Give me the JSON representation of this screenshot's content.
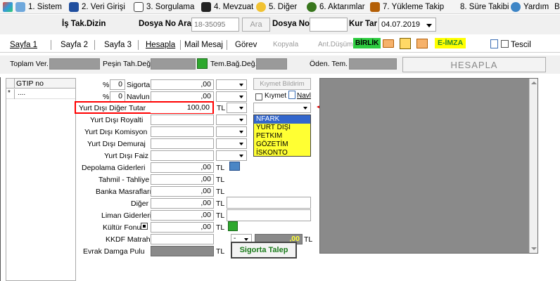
{
  "menu": [
    {
      "label": "1. Sistem",
      "icon": "system-icon"
    },
    {
      "label": "2. Veri Girişi",
      "icon": "edit-icon"
    },
    {
      "label": "3. Sorgulama",
      "icon": "query-icon"
    },
    {
      "label": "4. Mevzuat",
      "icon": "book-icon"
    },
    {
      "label": "5. Diğer",
      "icon": "people-icon"
    },
    {
      "label": "6. Aktarımlar",
      "icon": "transfer-icon"
    },
    {
      "label": "7. Yükleme Takip",
      "icon": "truck-icon"
    },
    {
      "label": "8. Süre Takibi",
      "icon": ""
    },
    {
      "label": "Yardım",
      "icon": "help-icon"
    },
    {
      "label": "B",
      "icon": ""
    }
  ],
  "header": {
    "title": "İş Tak.Dizin",
    "dosya_no_ara_label": "Dosya No Ara",
    "dosya_no_ara_placeholder": "18-35095",
    "ara_button": "Ara",
    "dosya_no_label": "Dosya No",
    "dosya_no_value": "",
    "kur_tar_label": "Kur Tar",
    "kur_tar_value": "04.07.2019"
  },
  "tabs": {
    "items": [
      "Sayfa 1",
      "Sayfa 2",
      "Sayfa 3",
      "Hesapla",
      "Mail Mesaj",
      "Görev",
      "Kopyala",
      "Ant.Düşüm"
    ],
    "birlik": "BİRLİK",
    "eimza": "E-İMZA",
    "tescil": "Tescil"
  },
  "totals": {
    "toplam_ver": "Toplam Ver.",
    "pesin_tah_deg": "Peşin Tah.Değ.",
    "tem_bag_deg": "Tem.Bağ.Değ.",
    "oden_tem": "Öden. Tem.",
    "hesapla": "HESAPLA"
  },
  "grid": {
    "header": "GTIP no",
    "row_marker": "*",
    "row_value": "...."
  },
  "form": {
    "pct1_label": "%",
    "pct1_value": "0",
    "sigorta_label": "Sigorta",
    "sigorta_value": ",00",
    "pct2_label": "%",
    "pct2_value": "0",
    "navlun_label": "Navlun",
    "navlun_value": ",00",
    "kiymet_bildirimi": "Kıymet Bildirim",
    "kiymet_label": "Kıymet",
    "navi_label": "Navl",
    "yurt_disi_diger_label": "Yurt Dışı Diğer Tutar",
    "yurt_disi_diger_value": "100,00",
    "yurt_disi_diger_unit": "TL",
    "yurt_disi_royalti": "Yurt Dışı Royalti",
    "yurt_disi_komisyon": "Yurt Dışı Komisyon",
    "yurt_disi_demuraj": "Yurt Dışı Demuraj",
    "yurt_disi_faiz": "Yurt Dışı Faiz",
    "depolama_label": "Depolama Giderleri",
    "depolama_value": ",00",
    "tahmil_label": "Tahmil - Tahliye",
    "tahmil_value": ",00",
    "banka_label": "Banka Masrafları",
    "banka_value": ",00",
    "diger_label": "Diğer",
    "diger_value": ",00",
    "liman_label": "Liman Giderleri",
    "liman_value": ",00",
    "kultur_label": "Kültür Fonu",
    "kultur_value": ",00",
    "kkdf_label": "KKDF Matrah",
    "evrak_label": "Evrak Damga Pulu",
    "tl": "TL",
    "kkdf_dash": "-",
    "kkdf_value": ",00",
    "sigorta_talep": "Sigorta Talep"
  },
  "dropdown_options": [
    "NFARK",
    "YURT DIŞI",
    "PETKIM",
    "GÖZETİM",
    "İSKONTO"
  ],
  "colors": {
    "highlight_red": "#ff0000",
    "dropdown_bg": "#ffff33",
    "dropdown_selected": "#3366cc",
    "panel_gray": "#8a8a8a",
    "birlik_bg": "#2ecc40",
    "eimza_bg": "#ffff00"
  }
}
